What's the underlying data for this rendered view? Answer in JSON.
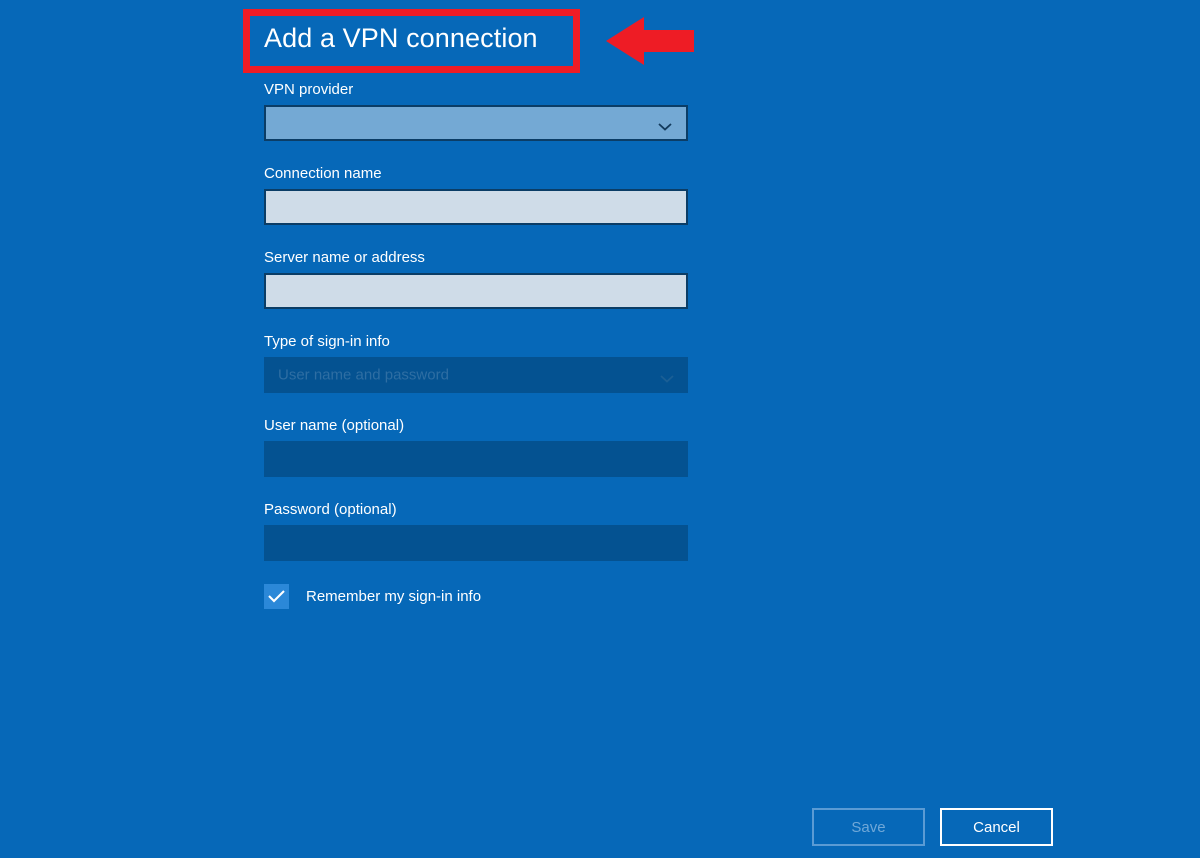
{
  "page": {
    "background_color": "#0668b8",
    "title": "Add a VPN connection"
  },
  "annotation": {
    "highlight_color": "#ee1c25",
    "arrow_name": "left-arrow-annotation",
    "arrow_color": "#ee1c25"
  },
  "form": {
    "fields": [
      {
        "label": "VPN provider",
        "type": "combobox",
        "value": "",
        "state": "focused"
      },
      {
        "label": "Connection name",
        "type": "text",
        "value": "",
        "state": "enabled"
      },
      {
        "label": "Server name or address",
        "type": "text",
        "value": "",
        "state": "enabled"
      },
      {
        "label": "Type of sign-in info",
        "type": "combobox",
        "value": "User name and password",
        "state": "disabled"
      },
      {
        "label": "User name (optional)",
        "type": "text",
        "value": "",
        "state": "disabled"
      },
      {
        "label": "Password (optional)",
        "type": "text",
        "value": "",
        "state": "disabled"
      }
    ],
    "checkbox": {
      "label": "Remember my sign-in info",
      "checked": true,
      "color": "#2b88d8"
    }
  },
  "footer": {
    "save_label": "Save",
    "save_state": "disabled",
    "cancel_label": "Cancel",
    "cancel_state": "enabled"
  }
}
